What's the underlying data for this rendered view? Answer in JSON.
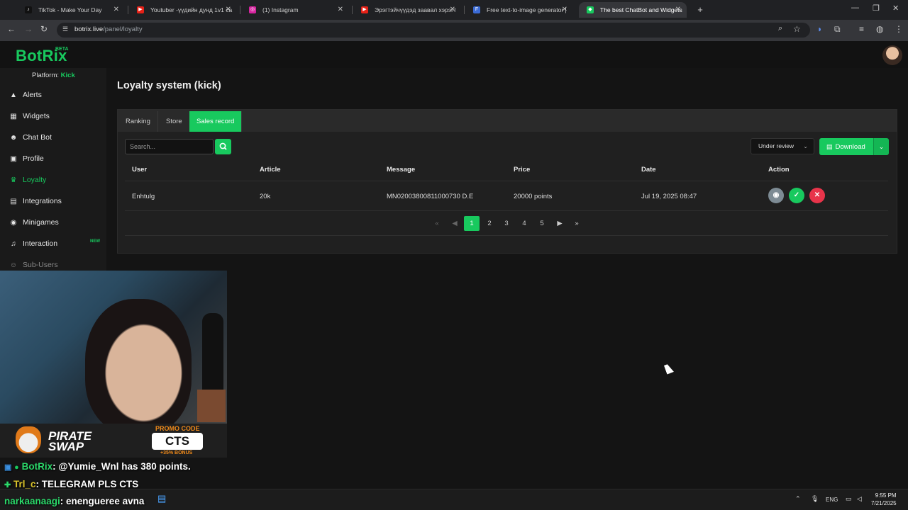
{
  "browser": {
    "tabs": [
      {
        "title": "TikTok - Make Your Day",
        "color": "#111111",
        "glyph": "♪"
      },
      {
        "title": "Youtuber -үүдийн дунд 1v1 ca",
        "color": "#e62117",
        "glyph": "▶"
      },
      {
        "title": "(1) Instagram",
        "color": "#d6249f",
        "glyph": "◎"
      },
      {
        "title": "Эрэгтэйчүүдэд заавал хэрэгт",
        "color": "#e62117",
        "glyph": "▶"
      },
      {
        "title": "Free text-to-image generator |",
        "color": "#3b6bd6",
        "glyph": "F"
      },
      {
        "title": "The best ChatBot and Widgets",
        "color": "#18c95e",
        "glyph": "◆"
      }
    ],
    "url_host": "botrix.live",
    "url_path": "/panel/loyalty"
  },
  "app": {
    "logo": "BotRix",
    "beta": "BETA",
    "platform_label": "Platform:",
    "platform_value": "Kick",
    "nav": [
      {
        "label": "Alerts",
        "icon": "▲"
      },
      {
        "label": "Widgets",
        "icon": "▦"
      },
      {
        "label": "Chat Bot",
        "icon": "☻"
      },
      {
        "label": "Profile",
        "icon": "▣"
      },
      {
        "label": "Loyalty",
        "icon": "♛"
      },
      {
        "label": "Integrations",
        "icon": "▤"
      },
      {
        "label": "Minigames",
        "icon": "◉"
      },
      {
        "label": "Interaction",
        "icon": "♫",
        "badge": "NEW"
      },
      {
        "label": "Sub-Users",
        "icon": "☺"
      }
    ]
  },
  "page": {
    "title": "Loyalty system (kick)",
    "tabs": [
      "Ranking",
      "Store",
      "Sales record"
    ],
    "search_placeholder": "Search...",
    "status_select": "Under review",
    "download_label": "Download",
    "columns": [
      "User",
      "Article",
      "Message",
      "Price",
      "Date",
      "Action"
    ],
    "rows": [
      {
        "user": "Enhtulg",
        "article": "20k",
        "message": "MN02003800811000730 D.E",
        "price": "20000 points",
        "date": "Jul 19, 2025 08:47"
      }
    ],
    "pagination": [
      "1",
      "2",
      "3",
      "4",
      "5"
    ]
  },
  "overlay": {
    "promo_brand": "PIRATE SWAP",
    "promo_brand_line1": "PIRATE",
    "promo_brand_line2": "SWAP",
    "promo_label": "PROMO CODE",
    "promo_code": "CTS",
    "promo_bonus": "+35% BONUS",
    "chat": [
      {
        "user": "BotRix",
        "text": ": @Yumie_Wnl has 380 points."
      },
      {
        "user": "Trl_c",
        "text": ": TELEGRAM PLS CTS"
      },
      {
        "user": "narkaanaagi",
        "text": ": enenguerее avna"
      }
    ]
  },
  "taskbar": {
    "lang": "ENG",
    "time": "9:55 PM",
    "date": "7/21/2025"
  },
  "colors": {
    "accent": "#18c95e",
    "danger": "#e8344a",
    "view": "#7d8b94"
  }
}
